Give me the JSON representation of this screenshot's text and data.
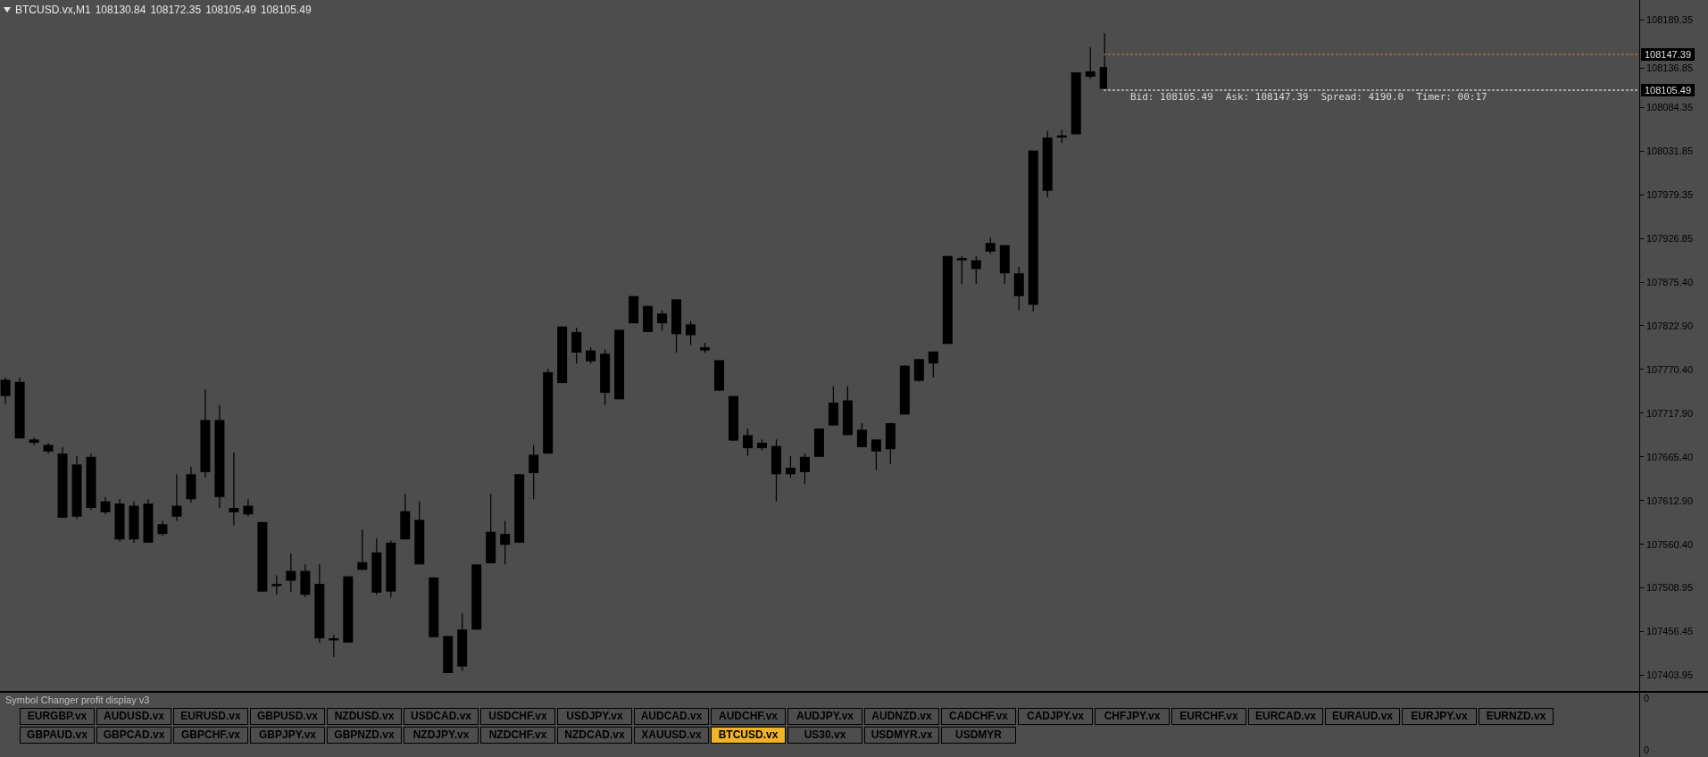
{
  "header": {
    "symbol": "BTCUSD.vx,M1",
    "ohlc": [
      "108130.84",
      "108172.35",
      "108105.49",
      "108105.49"
    ]
  },
  "price_axis": {
    "labels": [
      "108189.35",
      "108136.85",
      "108084.35",
      "108031.85",
      "107979.35",
      "107926.85",
      "107875.40",
      "107822.90",
      "107770.40",
      "107717.90",
      "107665.40",
      "107612.90",
      "107560.40",
      "107508.95",
      "107456.45",
      "107403.95"
    ]
  },
  "price_markers": [
    {
      "kind": "ask",
      "label": "108147.39"
    },
    {
      "kind": "bid",
      "label": "108105.49"
    }
  ],
  "info_line": [
    "Bid: 108105.49",
    "Ask: 108147.39",
    "Spread: 4190.0",
    "Timer: 00:17"
  ],
  "indicator_panel": {
    "title": "Symbol Changer profit display v3",
    "axis_labels": [
      "0",
      "0"
    ],
    "rows": [
      [
        {
          "label": "EURGBP.vx",
          "selected": false
        },
        {
          "label": "AUDUSD.vx",
          "selected": false
        },
        {
          "label": "EURUSD.vx",
          "selected": false
        },
        {
          "label": "GBPUSD.vx",
          "selected": false
        },
        {
          "label": "NZDUSD.vx",
          "selected": false
        },
        {
          "label": "USDCAD.vx",
          "selected": false
        },
        {
          "label": "USDCHF.vx",
          "selected": false
        },
        {
          "label": "USDJPY.vx",
          "selected": false
        },
        {
          "label": "AUDCAD.vx",
          "selected": false
        },
        {
          "label": "AUDCHF.vx",
          "selected": false
        },
        {
          "label": "AUDJPY.vx",
          "selected": false
        },
        {
          "label": "AUDNZD.vx",
          "selected": false
        },
        {
          "label": "CADCHF.vx",
          "selected": false
        },
        {
          "label": "CADJPY.vx",
          "selected": false
        },
        {
          "label": "CHFJPY.vx",
          "selected": false
        },
        {
          "label": "EURCHF.vx",
          "selected": false
        },
        {
          "label": "EURCAD.vx",
          "selected": false
        },
        {
          "label": "EURAUD.vx",
          "selected": false
        },
        {
          "label": "EURJPY.vx",
          "selected": false
        },
        {
          "label": "EURNZD.vx",
          "selected": false
        }
      ],
      [
        {
          "label": "GBPAUD.vx",
          "selected": false
        },
        {
          "label": "GBPCAD.vx",
          "selected": false
        },
        {
          "label": "GBPCHF.vx",
          "selected": false
        },
        {
          "label": "GBPJPY.vx",
          "selected": false
        },
        {
          "label": "GBPNZD.vx",
          "selected": false
        },
        {
          "label": "NZDJPY.vx",
          "selected": false
        },
        {
          "label": "NZDCHF.vx",
          "selected": false
        },
        {
          "label": "NZDCAD.vx",
          "selected": false
        },
        {
          "label": "XAUUSD.vx",
          "selected": false
        },
        {
          "label": "BTCUSD.vx",
          "selected": true
        },
        {
          "label": "US30.vx",
          "selected": false
        },
        {
          "label": "USDMYR.vx",
          "selected": false
        },
        {
          "label": "USDMYR",
          "selected": false
        }
      ]
    ]
  }
}
